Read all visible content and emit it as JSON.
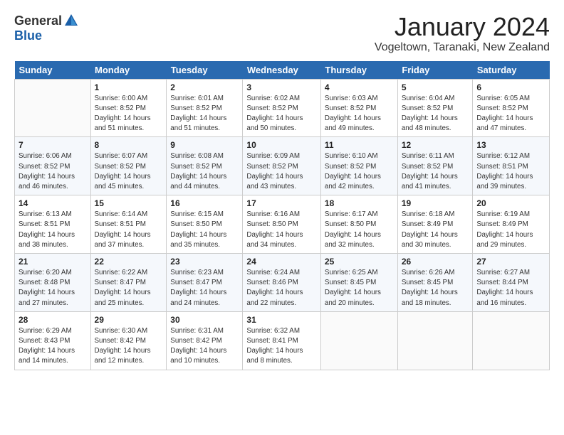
{
  "logo": {
    "general": "General",
    "blue": "Blue"
  },
  "title": "January 2024",
  "location": "Vogeltown, Taranaki, New Zealand",
  "headers": [
    "Sunday",
    "Monday",
    "Tuesday",
    "Wednesday",
    "Thursday",
    "Friday",
    "Saturday"
  ],
  "weeks": [
    [
      {
        "num": "",
        "detail": ""
      },
      {
        "num": "1",
        "detail": "Sunrise: 6:00 AM\nSunset: 8:52 PM\nDaylight: 14 hours\nand 51 minutes."
      },
      {
        "num": "2",
        "detail": "Sunrise: 6:01 AM\nSunset: 8:52 PM\nDaylight: 14 hours\nand 51 minutes."
      },
      {
        "num": "3",
        "detail": "Sunrise: 6:02 AM\nSunset: 8:52 PM\nDaylight: 14 hours\nand 50 minutes."
      },
      {
        "num": "4",
        "detail": "Sunrise: 6:03 AM\nSunset: 8:52 PM\nDaylight: 14 hours\nand 49 minutes."
      },
      {
        "num": "5",
        "detail": "Sunrise: 6:04 AM\nSunset: 8:52 PM\nDaylight: 14 hours\nand 48 minutes."
      },
      {
        "num": "6",
        "detail": "Sunrise: 6:05 AM\nSunset: 8:52 PM\nDaylight: 14 hours\nand 47 minutes."
      }
    ],
    [
      {
        "num": "7",
        "detail": "Sunrise: 6:06 AM\nSunset: 8:52 PM\nDaylight: 14 hours\nand 46 minutes."
      },
      {
        "num": "8",
        "detail": "Sunrise: 6:07 AM\nSunset: 8:52 PM\nDaylight: 14 hours\nand 45 minutes."
      },
      {
        "num": "9",
        "detail": "Sunrise: 6:08 AM\nSunset: 8:52 PM\nDaylight: 14 hours\nand 44 minutes."
      },
      {
        "num": "10",
        "detail": "Sunrise: 6:09 AM\nSunset: 8:52 PM\nDaylight: 14 hours\nand 43 minutes."
      },
      {
        "num": "11",
        "detail": "Sunrise: 6:10 AM\nSunset: 8:52 PM\nDaylight: 14 hours\nand 42 minutes."
      },
      {
        "num": "12",
        "detail": "Sunrise: 6:11 AM\nSunset: 8:52 PM\nDaylight: 14 hours\nand 41 minutes."
      },
      {
        "num": "13",
        "detail": "Sunrise: 6:12 AM\nSunset: 8:51 PM\nDaylight: 14 hours\nand 39 minutes."
      }
    ],
    [
      {
        "num": "14",
        "detail": "Sunrise: 6:13 AM\nSunset: 8:51 PM\nDaylight: 14 hours\nand 38 minutes."
      },
      {
        "num": "15",
        "detail": "Sunrise: 6:14 AM\nSunset: 8:51 PM\nDaylight: 14 hours\nand 37 minutes."
      },
      {
        "num": "16",
        "detail": "Sunrise: 6:15 AM\nSunset: 8:50 PM\nDaylight: 14 hours\nand 35 minutes."
      },
      {
        "num": "17",
        "detail": "Sunrise: 6:16 AM\nSunset: 8:50 PM\nDaylight: 14 hours\nand 34 minutes."
      },
      {
        "num": "18",
        "detail": "Sunrise: 6:17 AM\nSunset: 8:50 PM\nDaylight: 14 hours\nand 32 minutes."
      },
      {
        "num": "19",
        "detail": "Sunrise: 6:18 AM\nSunset: 8:49 PM\nDaylight: 14 hours\nand 30 minutes."
      },
      {
        "num": "20",
        "detail": "Sunrise: 6:19 AM\nSunset: 8:49 PM\nDaylight: 14 hours\nand 29 minutes."
      }
    ],
    [
      {
        "num": "21",
        "detail": "Sunrise: 6:20 AM\nSunset: 8:48 PM\nDaylight: 14 hours\nand 27 minutes."
      },
      {
        "num": "22",
        "detail": "Sunrise: 6:22 AM\nSunset: 8:47 PM\nDaylight: 14 hours\nand 25 minutes."
      },
      {
        "num": "23",
        "detail": "Sunrise: 6:23 AM\nSunset: 8:47 PM\nDaylight: 14 hours\nand 24 minutes."
      },
      {
        "num": "24",
        "detail": "Sunrise: 6:24 AM\nSunset: 8:46 PM\nDaylight: 14 hours\nand 22 minutes."
      },
      {
        "num": "25",
        "detail": "Sunrise: 6:25 AM\nSunset: 8:45 PM\nDaylight: 14 hours\nand 20 minutes."
      },
      {
        "num": "26",
        "detail": "Sunrise: 6:26 AM\nSunset: 8:45 PM\nDaylight: 14 hours\nand 18 minutes."
      },
      {
        "num": "27",
        "detail": "Sunrise: 6:27 AM\nSunset: 8:44 PM\nDaylight: 14 hours\nand 16 minutes."
      }
    ],
    [
      {
        "num": "28",
        "detail": "Sunrise: 6:29 AM\nSunset: 8:43 PM\nDaylight: 14 hours\nand 14 minutes."
      },
      {
        "num": "29",
        "detail": "Sunrise: 6:30 AM\nSunset: 8:42 PM\nDaylight: 14 hours\nand 12 minutes."
      },
      {
        "num": "30",
        "detail": "Sunrise: 6:31 AM\nSunset: 8:42 PM\nDaylight: 14 hours\nand 10 minutes."
      },
      {
        "num": "31",
        "detail": "Sunrise: 6:32 AM\nSunset: 8:41 PM\nDaylight: 14 hours\nand 8 minutes."
      },
      {
        "num": "",
        "detail": ""
      },
      {
        "num": "",
        "detail": ""
      },
      {
        "num": "",
        "detail": ""
      }
    ]
  ]
}
